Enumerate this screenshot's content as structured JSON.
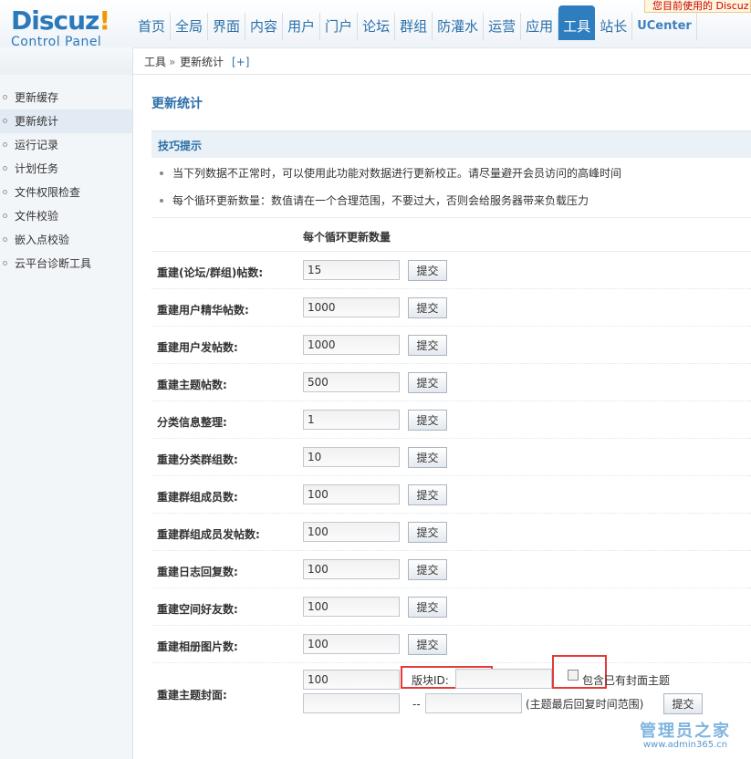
{
  "logo": {
    "brand": "Discuz",
    "bang": "!",
    "sub": "Control Panel"
  },
  "nav": [
    {
      "label": "首页"
    },
    {
      "label": "全局"
    },
    {
      "label": "界面"
    },
    {
      "label": "内容"
    },
    {
      "label": "用户"
    },
    {
      "label": "门户"
    },
    {
      "label": "论坛"
    },
    {
      "label": "群组"
    },
    {
      "label": "防灌水"
    },
    {
      "label": "运营"
    },
    {
      "label": "应用"
    },
    {
      "label": "工具"
    },
    {
      "label": "站长"
    },
    {
      "label": "UCenter"
    }
  ],
  "notice": "您目前使用的 Discuz",
  "breadcrumb": {
    "tools": "工具",
    "sep": "»",
    "current": "更新统计",
    "add": "[+]"
  },
  "sidebar": {
    "items": [
      {
        "label": "更新缓存"
      },
      {
        "label": "更新统计"
      },
      {
        "label": "运行记录"
      },
      {
        "label": "计划任务"
      },
      {
        "label": "文件权限检查"
      },
      {
        "label": "文件校验"
      },
      {
        "label": "嵌入点校验"
      },
      {
        "label": "云平台诊断工具"
      }
    ]
  },
  "page": {
    "title": "更新统计",
    "tips_title": "技巧提示",
    "tips": [
      "当下列数据不正常时，可以使用此功能对数据进行更新校正。请尽量避开会员访问的高峰时间",
      "每个循环更新数量：数值请在一个合理范围，不要过大，否则会给服务器带来负载压力"
    ],
    "column_header": "每个循环更新数量",
    "submit_label": "提交",
    "rows": [
      {
        "label": "重建(论坛/群组)帖数:",
        "value": "15"
      },
      {
        "label": "重建用户精华帖数:",
        "value": "1000"
      },
      {
        "label": "重建用户发帖数:",
        "value": "1000"
      },
      {
        "label": "重建主题帖数:",
        "value": "500"
      },
      {
        "label": "分类信息整理:",
        "value": "1"
      },
      {
        "label": "重建分类群组数:",
        "value": "10"
      },
      {
        "label": "重建群组成员数:",
        "value": "100"
      },
      {
        "label": "重建群组成员发帖数:",
        "value": "100"
      },
      {
        "label": "重建日志回复数:",
        "value": "100"
      },
      {
        "label": "重建空间好友数:",
        "value": "100"
      },
      {
        "label": "重建相册图片数:",
        "value": "100"
      }
    ],
    "cover": {
      "label": "重建主题封面:",
      "value": "100",
      "blockid_label": "版块ID:",
      "blockid_value": "",
      "checkbox_label": "包含已有封面主题",
      "date_from": "",
      "date_dash": "--",
      "date_to": "",
      "date_hint": "(主题最后回复时间范围)",
      "submit_label": "提交"
    }
  },
  "watermark": {
    "big": "管理员之家",
    "small": "www.admin365.cn"
  }
}
